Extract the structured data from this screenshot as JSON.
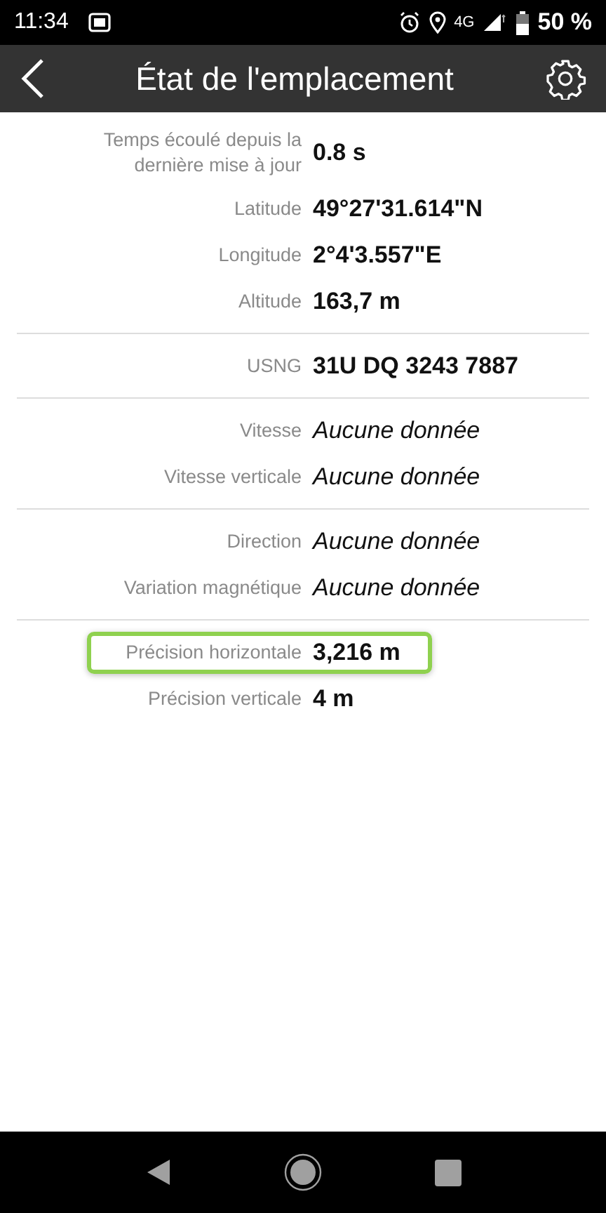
{
  "status_bar": {
    "time": "11:34",
    "network": "4G",
    "battery": "50 %"
  },
  "header": {
    "title": "État de l'emplacement"
  },
  "groups": [
    {
      "rows": [
        {
          "label": "Temps écoulé depuis la dernière mise à jour",
          "value": "0.8 s",
          "kind": "value",
          "highlighted": false
        },
        {
          "label": "Latitude",
          "value": "49°27'31.614\"N",
          "kind": "value",
          "highlighted": false
        },
        {
          "label": "Longitude",
          "value": "2°4'3.557\"E",
          "kind": "value",
          "highlighted": false
        },
        {
          "label": "Altitude",
          "value": "163,7 m",
          "kind": "value",
          "highlighted": false
        }
      ]
    },
    {
      "rows": [
        {
          "label": "USNG",
          "value": "31U DQ 3243 7887",
          "kind": "value",
          "highlighted": false
        }
      ]
    },
    {
      "rows": [
        {
          "label": "Vitesse",
          "value": "Aucune donnée",
          "kind": "no_data",
          "highlighted": false
        },
        {
          "label": "Vitesse verticale",
          "value": "Aucune donnée",
          "kind": "no_data",
          "highlighted": false
        }
      ]
    },
    {
      "rows": [
        {
          "label": "Direction",
          "value": "Aucune donnée",
          "kind": "no_data",
          "highlighted": false
        },
        {
          "label": "Variation magnétique",
          "value": "Aucune donnée",
          "kind": "no_data",
          "highlighted": false
        }
      ]
    },
    {
      "rows": [
        {
          "label": "Précision horizontale",
          "value": "3,216 m",
          "kind": "value",
          "highlighted": true
        },
        {
          "label": "Précision verticale",
          "value": "4 m",
          "kind": "value",
          "highlighted": false
        }
      ]
    }
  ]
}
